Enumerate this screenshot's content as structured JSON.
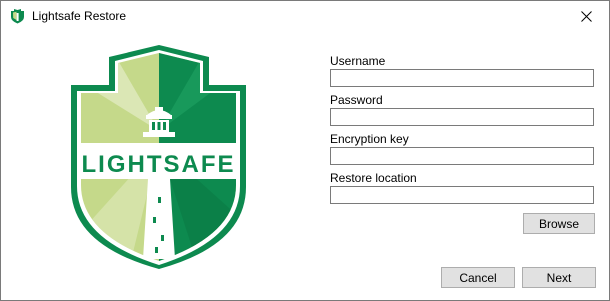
{
  "window": {
    "title": "Lightsafe Restore",
    "close_glyph": "✕"
  },
  "logo": {
    "text": "LIGHTSAFE",
    "icon": "lighthouse-shield-logo",
    "colors": {
      "dark_green": "#0d8a4f",
      "light_green": "#c5d98a",
      "white": "#ffffff"
    }
  },
  "form": {
    "username": {
      "label": "Username",
      "value": ""
    },
    "password": {
      "label": "Password",
      "value": ""
    },
    "encryption_key": {
      "label": "Encryption key",
      "value": ""
    },
    "restore_location": {
      "label": "Restore location",
      "value": ""
    }
  },
  "buttons": {
    "browse": "Browse",
    "cancel": "Cancel",
    "next": "Next"
  }
}
